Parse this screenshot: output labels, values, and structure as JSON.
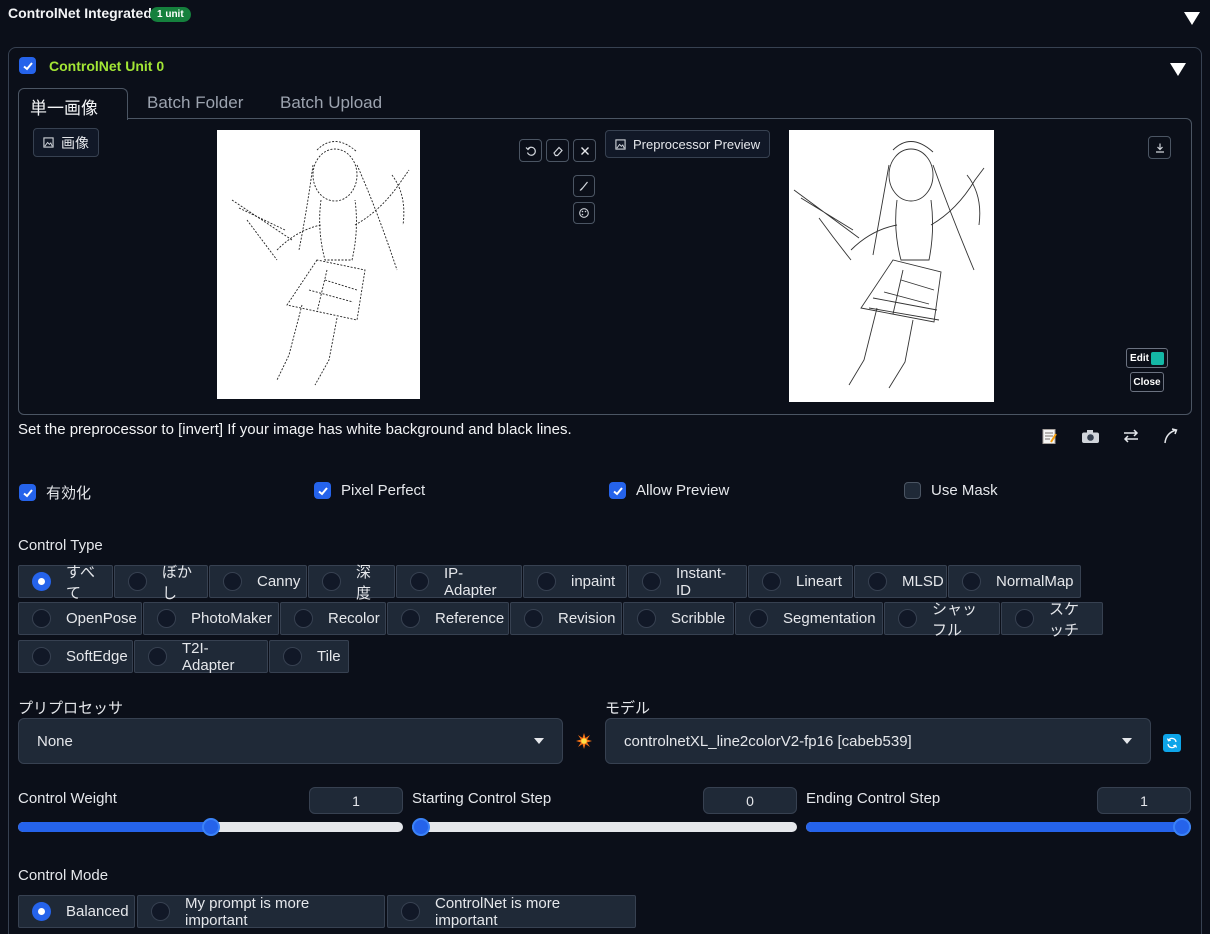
{
  "header": {
    "title": "ControlNet Integrated",
    "badge": "1 unit"
  },
  "unit": {
    "title": "ControlNet Unit 0",
    "enabled": true
  },
  "tabs": [
    {
      "label": "単一画像",
      "active": true
    },
    {
      "label": "Batch Folder",
      "active": false
    },
    {
      "label": "Batch Upload",
      "active": false
    }
  ],
  "image_panel": {
    "input_label": "画像",
    "preview_label": "Preprocessor Preview",
    "edit_label": "Edit",
    "close_label": "Close"
  },
  "hint": "Set the preprocessor to [invert] If your image has white background and black lines.",
  "options": {
    "enable": {
      "label": "有効化",
      "checked": true
    },
    "pixel_perfect": {
      "label": "Pixel Perfect",
      "checked": true
    },
    "allow_preview": {
      "label": "Allow Preview",
      "checked": true
    },
    "use_mask": {
      "label": "Use Mask",
      "checked": false
    }
  },
  "control_type": {
    "label": "Control Type",
    "selected": "すべて",
    "items": [
      "すべて",
      "ぼかし",
      "Canny",
      "深度",
      "IP-Adapter",
      "inpaint",
      "Instant-ID",
      "Lineart",
      "MLSD",
      "NormalMap",
      "OpenPose",
      "PhotoMaker",
      "Recolor",
      "Reference",
      "Revision",
      "Scribble",
      "Segmentation",
      "シャッフル",
      "スケッチ",
      "SoftEdge",
      "T2I-Adapter",
      "Tile"
    ]
  },
  "preprocessor": {
    "label": "プリプロセッサ",
    "value": "None"
  },
  "model": {
    "label": "モデル",
    "value": "controlnetXL_line2colorV2-fp16 [cabeb539]"
  },
  "sliders": {
    "weight": {
      "label": "Control Weight",
      "value": "1",
      "fraction": 0.5
    },
    "start": {
      "label": "Starting Control Step",
      "value": "0",
      "fraction": 0.0
    },
    "end": {
      "label": "Ending Control Step",
      "value": "1",
      "fraction": 1.0
    }
  },
  "control_mode": {
    "label": "Control Mode",
    "selected": "Balanced",
    "items": [
      "Balanced",
      "My prompt is more important",
      "ControlNet is more important"
    ]
  },
  "colors": {
    "accent": "#2563eb",
    "unit_title": "#a3e635",
    "badge": "#15803d",
    "background": "#0b0f19"
  }
}
